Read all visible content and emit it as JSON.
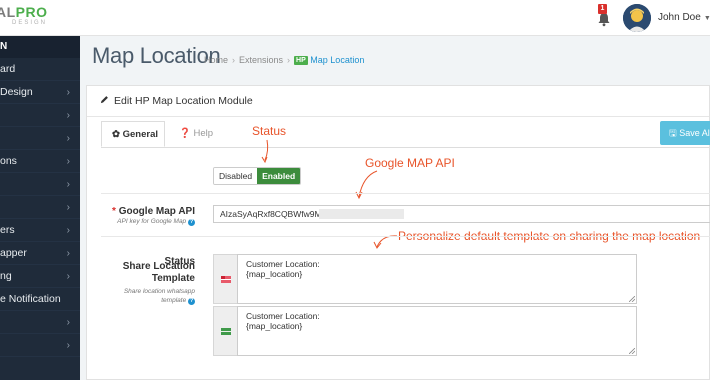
{
  "logo": {
    "main_prefix": "AL",
    "main_accent": "PRO",
    "sub": "DESIGN"
  },
  "sidebar": {
    "head": "N",
    "items": [
      {
        "label": "ard",
        "has_arrow": false
      },
      {
        "label": " Design",
        "has_arrow": true
      },
      {
        "label": "",
        "has_arrow": true
      },
      {
        "label": "",
        "has_arrow": true
      },
      {
        "label": "ons",
        "has_arrow": true
      },
      {
        "label": "",
        "has_arrow": true
      },
      {
        "label": "",
        "has_arrow": true
      },
      {
        "label": "ers",
        "has_arrow": true
      },
      {
        "label": "apper",
        "has_arrow": true
      },
      {
        "label": "ng",
        "has_arrow": true
      },
      {
        "label": "e Notification",
        "has_arrow": false
      },
      {
        "label": "",
        "has_arrow": true
      },
      {
        "label": "",
        "has_arrow": true
      }
    ]
  },
  "header": {
    "notification_count": "1",
    "username": "John Doe",
    "caret": "▼"
  },
  "page": {
    "title": "Map Location",
    "breadcrumb": {
      "home": "Home",
      "extensions": "Extensions",
      "badge": "HP",
      "current": "Map Location"
    }
  },
  "panel": {
    "title": "Edit HP Map Location Module",
    "save_label": "Save All",
    "tabs": {
      "general": "General",
      "help": "Help"
    }
  },
  "annotations": {
    "status": "Status",
    "api": "Google MAP API",
    "template": "Personalize default template on sharing the map location"
  },
  "form": {
    "status": {
      "label": "Status",
      "off": "Disabled",
      "on": "Enabled",
      "value": "Enabled"
    },
    "api": {
      "required_mark": "*",
      "label": "Google Map API",
      "help": "API key for Google Map",
      "value": "AIzaSyAqRxf8CQBWfw9MR"
    },
    "template": {
      "label_line1": "Share Location",
      "label_line2": "Template",
      "help_line1": "Share location whatsapp",
      "help_line2": "template",
      "entries": [
        {
          "text": "Customer Location:\n{map_location}",
          "flag": "flag-icon-red"
        },
        {
          "text": "Customer Location:\n{map_location}",
          "flag": "flag-icon-green"
        }
      ]
    }
  },
  "colors": {
    "accent_green": "#4cae4c",
    "annotation": "#e8542a",
    "sidebar_bg": "#1f2b3a",
    "link": "#1e91cf",
    "save_button": "#5bc0de"
  }
}
